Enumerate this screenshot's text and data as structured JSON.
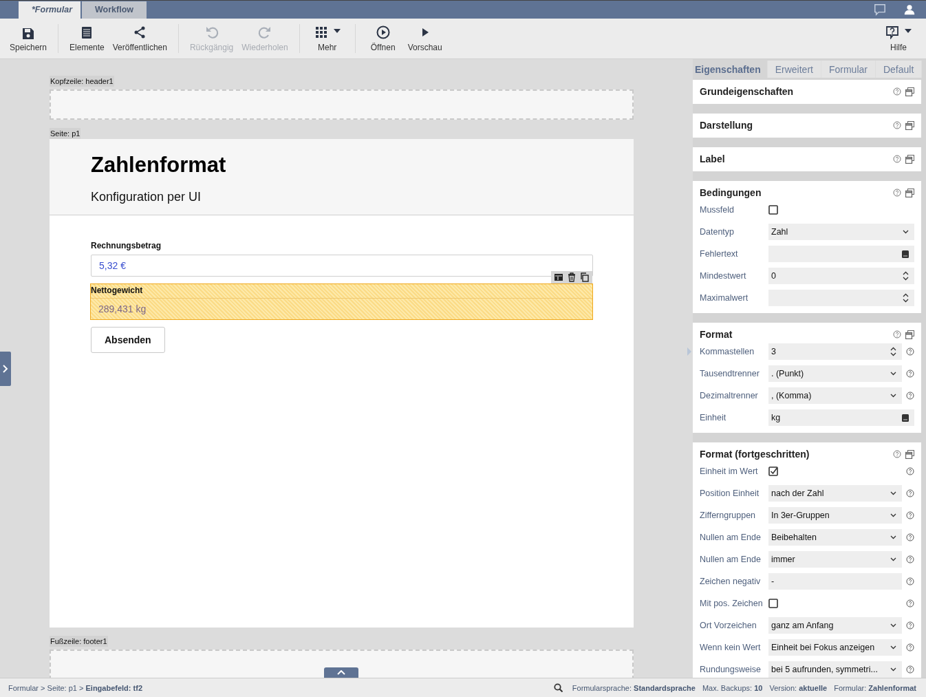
{
  "top_tabs": [
    {
      "label": "*Formular",
      "selected": true
    },
    {
      "label": "Workflow",
      "selected": false
    }
  ],
  "toolbar": {
    "groups": [
      [
        {
          "label": "Speichern",
          "disabled": false,
          "dropdown": false
        }
      ],
      [
        {
          "label": "Elemente",
          "disabled": false,
          "dropdown": false
        },
        {
          "label": "Veröffentlichen",
          "disabled": false,
          "dropdown": false
        }
      ],
      [
        {
          "label": "Rückgängig",
          "disabled": true,
          "dropdown": false
        },
        {
          "label": "Wiederholen",
          "disabled": true,
          "dropdown": false
        }
      ],
      [
        {
          "label": "Mehr",
          "disabled": false,
          "dropdown": true
        }
      ],
      [
        {
          "label": "Öffnen",
          "disabled": false,
          "dropdown": false
        },
        {
          "label": "Vorschau",
          "disabled": false,
          "dropdown": false
        }
      ]
    ],
    "help": {
      "label": "Hilfe",
      "dropdown": true
    }
  },
  "canvas": {
    "header_label": "Kopfzeile: header1",
    "page_label": "Seite: p1",
    "title": "Zahlenformat",
    "subtitle": "Konfiguration per UI",
    "fields": [
      {
        "label": "Rechnungsbetrag",
        "value": "5,32 €",
        "selected": false
      },
      {
        "label": "Nettogewicht",
        "value": "289,431 kg",
        "selected": true
      }
    ],
    "submit": "Absenden",
    "footer_label": "Fußzeile: footer1"
  },
  "properties": {
    "tabs": [
      {
        "label": "Eigenschaften",
        "selected": true
      },
      {
        "label": "Erweitert",
        "selected": false
      },
      {
        "label": "Formular",
        "selected": false
      },
      {
        "label": "Default",
        "selected": false
      }
    ],
    "sections": [
      {
        "title": "Grundeigenschaften"
      },
      {
        "title": "Darstellung"
      },
      {
        "title": "Label"
      },
      {
        "title": "Bedingungen",
        "rows": [
          {
            "label": "Mussfeld",
            "kind": "checkbox",
            "checked": false,
            "help": false
          },
          {
            "label": "Datentyp",
            "kind": "select",
            "value": "Zahl",
            "help": false
          },
          {
            "label": "Fehlertext",
            "kind": "book",
            "help": false
          },
          {
            "label": "Mindestwert",
            "kind": "number",
            "value": "0",
            "help": false
          },
          {
            "label": "Maximalwert",
            "kind": "number",
            "help": false
          }
        ]
      },
      {
        "title": "Format",
        "rows": [
          {
            "label": "Kommastellen",
            "kind": "number",
            "value": "3",
            "help": true
          },
          {
            "label": "Tausendtrenner",
            "kind": "select",
            "value": ". (Punkt)",
            "help": true
          },
          {
            "label": "Dezimaltrenner",
            "kind": "select",
            "value": ", (Komma)",
            "help": true
          },
          {
            "label": "Einheit",
            "kind": "book",
            "value": "kg",
            "help": false
          }
        ]
      },
      {
        "title": "Format (fortgeschritten)",
        "rows": [
          {
            "label": "Einheit im Wert",
            "kind": "checkbox",
            "checked": true,
            "help": true
          },
          {
            "label": "Position Einheit",
            "kind": "select",
            "value": "nach der Zahl",
            "help": true
          },
          {
            "label": "Zifferngruppen",
            "kind": "select",
            "value": "In 3er-Gruppen",
            "help": true
          },
          {
            "label": "Nullen am Ende",
            "kind": "select",
            "value": "Beibehalten",
            "help": true
          },
          {
            "label": "Nullen am Ende",
            "kind": "select",
            "value": "immer",
            "help": true
          },
          {
            "label": "Zeichen negativ",
            "kind": "text",
            "value": "-",
            "help": true
          },
          {
            "label": "Mit pos. Zeichen",
            "kind": "checkbox",
            "checked": false,
            "help": true
          },
          {
            "label": "Ort Vorzeichen",
            "kind": "select",
            "value": "ganz am Anfang",
            "help": true
          },
          {
            "label": "Wenn kein Wert",
            "kind": "select",
            "value": "Einheit bei Fokus anzeigen",
            "help": true
          },
          {
            "label": "Rundungsweise",
            "kind": "select",
            "value": "bei 5 aufrunden, symmetri...",
            "help": true
          }
        ]
      }
    ]
  },
  "status_bar": {
    "breadcrumb": "Formular > Seite: p1 > **Eingabefeld: tf2**",
    "items": [
      {
        "label": "Formularsprache:",
        "value": "Standardsprache"
      },
      {
        "label": "Max. Backups:",
        "value": "10"
      },
      {
        "label": "Version:",
        "value": "aktuelle"
      },
      {
        "label": "Formular:",
        "value": "Zahlenformat"
      }
    ]
  }
}
